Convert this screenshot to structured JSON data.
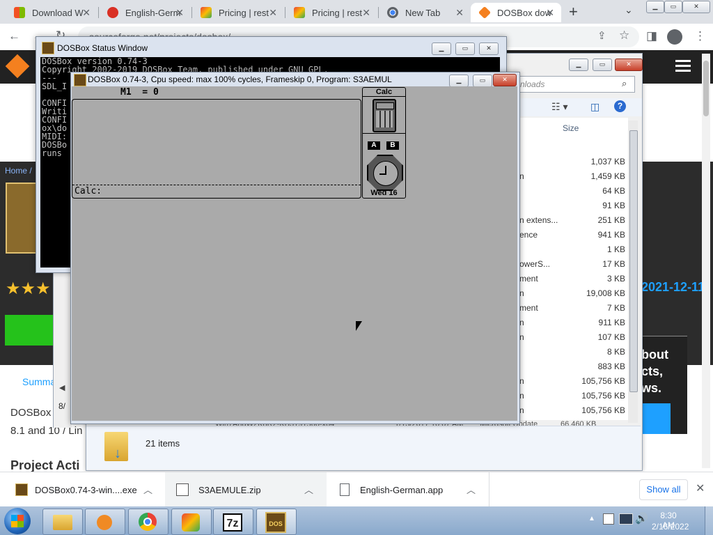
{
  "browser": {
    "tabs": [
      {
        "label": "Download W",
        "color": "#ea4335"
      },
      {
        "label": "English-Germ",
        "color": "#d93025"
      },
      {
        "label": "Pricing | rest",
        "color": "#34a853"
      },
      {
        "label": "Pricing | rest",
        "color": "#34a853"
      },
      {
        "label": "New Tab",
        "color": "#5f6368"
      },
      {
        "label": "DOSBox dow",
        "color": "#f4801f"
      }
    ],
    "address": "sourceforge.net/projects/dosbox/"
  },
  "website": {
    "breadcrumb": "Home / ",
    "date": "2021-12-11",
    "side_text": [
      "bout",
      "cts,",
      "ws."
    ],
    "summary_tab": "Summa",
    "desc_line1": "DOSBox",
    "desc_line2": "8.1 and 10 / Lin",
    "section_title": "Project Acti"
  },
  "explorer": {
    "search_placeholder": "nloads",
    "column_size": "Size",
    "rows": [
      {
        "type": "",
        "size": "1,037 KB"
      },
      {
        "type": "n",
        "size": "1,459 KB"
      },
      {
        "type": "",
        "size": "64 KB"
      },
      {
        "type": "",
        "size": "91 KB"
      },
      {
        "type": "n extens...",
        "size": "251 KB"
      },
      {
        "type": "ence",
        "size": "941 KB"
      },
      {
        "type": "",
        "size": "1 KB"
      },
      {
        "type": "owerS...",
        "size": "17 KB"
      },
      {
        "type": "ment",
        "size": "3 KB"
      },
      {
        "type": "n",
        "size": "19,008 KB"
      },
      {
        "type": "ment",
        "size": "7 KB"
      },
      {
        "type": "n",
        "size": "911 KB"
      },
      {
        "type": "n",
        "size": "107 KB"
      },
      {
        "type": "",
        "size": "8 KB"
      },
      {
        "type": "",
        "size": "883 KB"
      },
      {
        "type": "n",
        "size": "105,756 KB"
      },
      {
        "type": "n",
        "size": "105,756 KB"
      },
      {
        "type": "n",
        "size": "105,756 KB"
      }
    ],
    "last_row": {
      "name": "Win7AndW2K8R2-KB3191566-x64",
      "date": "1/13/2017 10:07 AM",
      "type": "Microsoft Update",
      "size": "66,460 KB"
    },
    "items_count": "21 items",
    "status_left": "8/"
  },
  "dosbox_status": {
    "title": "DOSBox Status Window",
    "lines": [
      "DOSBox version 0.74-3",
      "Copyright 2002-2019 DOSBox Team, published under GNU GPL.",
      "---",
      "SDL_I",
      "",
      "CONFI",
      "Writi",
      "CONFI",
      "ox\\do",
      "MIDI:",
      "DOSBo",
      "runs"
    ]
  },
  "dosbox_main": {
    "title": "DOSBox 0.74-3, Cpu speed: max 100% cycles, Frameskip  0, Program:  S3AEMUL",
    "memory_line": "M1  = 0",
    "calc_prompt": "Calc:",
    "widget_calc": "Calc",
    "key_a": "A",
    "key_b": "B",
    "clock_day": "Wed 16"
  },
  "downloads": [
    {
      "name": "DOSBox0.74-3-win....exe"
    },
    {
      "name": "S3AEMULE.zip"
    },
    {
      "name": "English-German.app"
    }
  ],
  "show_all": "Show all",
  "taskbar": {
    "time": "8:30 AM",
    "date": "2/16/2022",
    "app_7z": "7z",
    "app_dos": "DOS"
  }
}
